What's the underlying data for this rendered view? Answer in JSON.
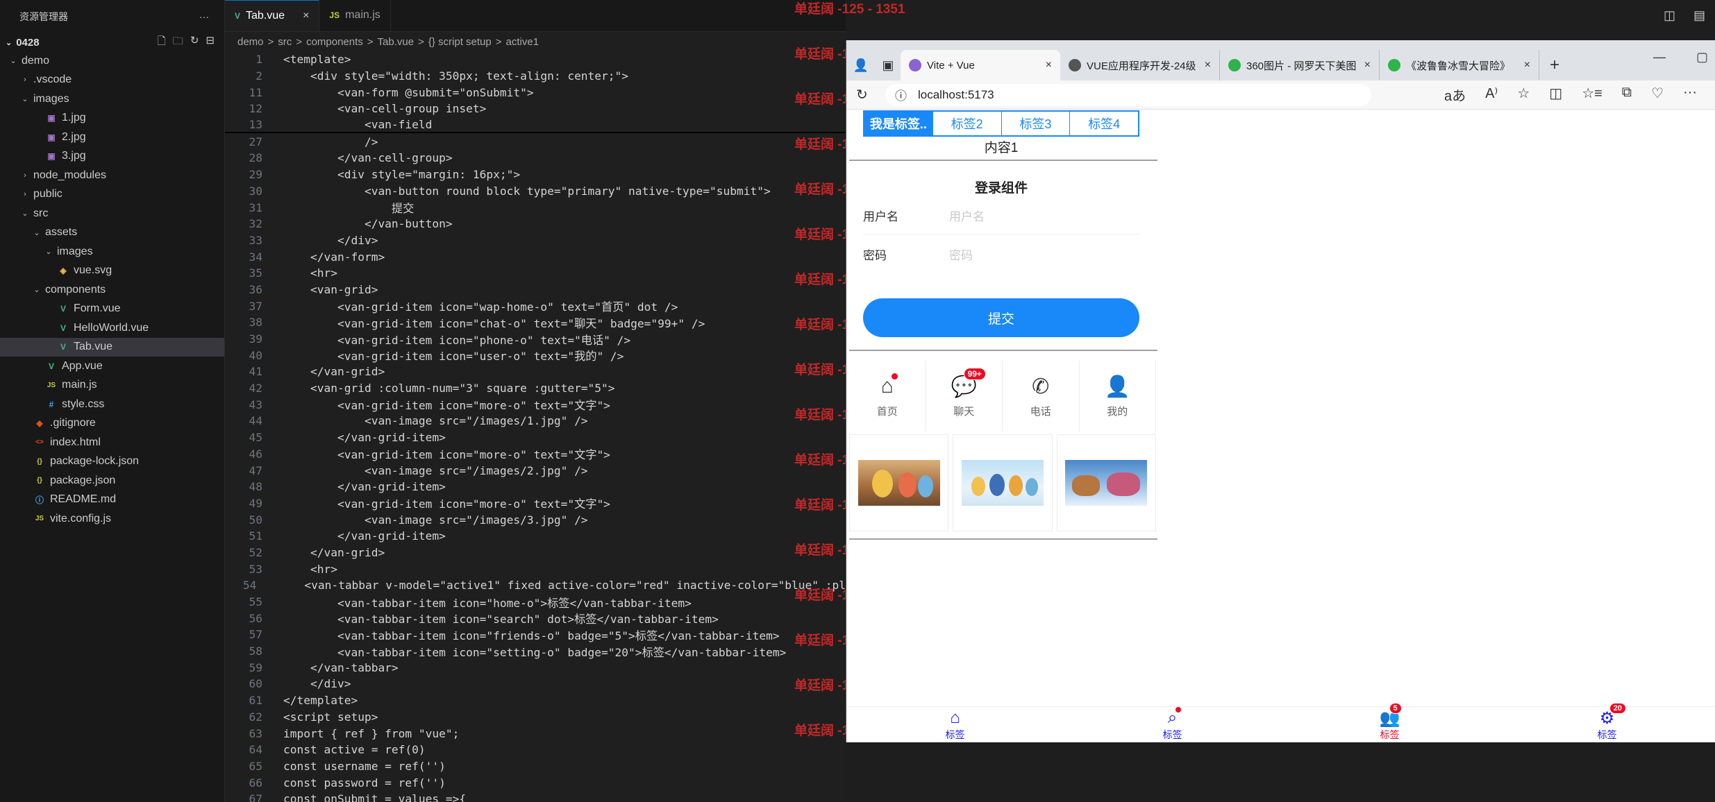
{
  "explorer": {
    "title": "资源管理器",
    "more": "···",
    "project": "0428",
    "items": [
      {
        "label": "demo",
        "icon": "folder-open",
        "chev": "⌄",
        "indent": 1
      },
      {
        "label": ".vscode",
        "icon": "folder",
        "chev": "›",
        "indent": 2
      },
      {
        "label": "images",
        "icon": "folder-open",
        "chev": "⌄",
        "indent": 2
      },
      {
        "label": "1.jpg",
        "icon": "image-file",
        "chev": "",
        "indent": 3
      },
      {
        "label": "2.jpg",
        "icon": "image-file",
        "chev": "",
        "indent": 3
      },
      {
        "label": "3.jpg",
        "icon": "image-file",
        "chev": "",
        "indent": 3
      },
      {
        "label": "node_modules",
        "icon": "folder",
        "chev": "›",
        "indent": 2
      },
      {
        "label": "public",
        "icon": "folder",
        "chev": "›",
        "indent": 2
      },
      {
        "label": "src",
        "icon": "folder-open",
        "chev": "⌄",
        "indent": 2
      },
      {
        "label": "assets",
        "icon": "folder-open",
        "chev": "⌄",
        "indent": 3
      },
      {
        "label": "images",
        "icon": "folder-open",
        "chev": "⌄",
        "indent": 4
      },
      {
        "label": "vue.svg",
        "icon": "svg-file",
        "chev": "",
        "indent": 4
      },
      {
        "label": "components",
        "icon": "folder-open",
        "chev": "⌄",
        "indent": 3
      },
      {
        "label": "Form.vue",
        "icon": "vue-file",
        "chev": "",
        "indent": 4
      },
      {
        "label": "HelloWorld.vue",
        "icon": "vue-file",
        "chev": "",
        "indent": 4
      },
      {
        "label": "Tab.vue",
        "icon": "vue-file",
        "chev": "",
        "indent": 4,
        "selected": true
      },
      {
        "label": "App.vue",
        "icon": "vue-file",
        "chev": "",
        "indent": 3
      },
      {
        "label": "main.js",
        "icon": "js-file",
        "chev": "",
        "indent": 3
      },
      {
        "label": "style.css",
        "icon": "css-file",
        "chev": "",
        "indent": 3
      },
      {
        "label": ".gitignore",
        "icon": "git-file",
        "chev": "",
        "indent": 2
      },
      {
        "label": "index.html",
        "icon": "html-file",
        "chev": "",
        "indent": 2
      },
      {
        "label": "package-lock.json",
        "icon": "json-file",
        "chev": "",
        "indent": 2
      },
      {
        "label": "package.json",
        "icon": "json-file",
        "chev": "",
        "indent": 2
      },
      {
        "label": "README.md",
        "icon": "info-file",
        "chev": "",
        "indent": 2
      },
      {
        "label": "vite.config.js",
        "icon": "js-file",
        "chev": "",
        "indent": 2
      }
    ]
  },
  "editor": {
    "tabs": [
      {
        "label": "Tab.vue",
        "active": true,
        "close": "×"
      },
      {
        "label": "main.js",
        "active": false,
        "close": ""
      }
    ],
    "breadcrumbs": [
      "demo",
      ">",
      "src",
      ">",
      "components",
      ">",
      "Tab.vue",
      ">",
      "{} script setup",
      ">",
      "active1"
    ],
    "lines": [
      {
        "no": "1",
        "text": "<template>"
      },
      {
        "no": "2",
        "text": "    <div style=\"width: 350px; text-align: center;\">"
      },
      {
        "no": "11",
        "text": "        <van-form @submit=\"onSubmit\">"
      },
      {
        "no": "12",
        "text": "        <van-cell-group inset>"
      },
      {
        "no": "13",
        "text": "            <van-field"
      },
      {
        "no": "27",
        "text": "            />"
      },
      {
        "no": "28",
        "text": "        </van-cell-group>"
      },
      {
        "no": "29",
        "text": "        <div style=\"margin: 16px;\">"
      },
      {
        "no": "30",
        "text": "            <van-button round block type=\"primary\" native-type=\"submit\">"
      },
      {
        "no": "31",
        "text": "                提交"
      },
      {
        "no": "32",
        "text": "            </van-button>"
      },
      {
        "no": "33",
        "text": "        </div>"
      },
      {
        "no": "34",
        "text": "    </van-form>"
      },
      {
        "no": "35",
        "text": "    <hr>"
      },
      {
        "no": "36",
        "text": "    <van-grid>"
      },
      {
        "no": "37",
        "text": "        <van-grid-item icon=\"wap-home-o\" text=\"首页\" dot />"
      },
      {
        "no": "38",
        "text": "        <van-grid-item icon=\"chat-o\" text=\"聊天\" badge=\"99+\" />"
      },
      {
        "no": "39",
        "text": "        <van-grid-item icon=\"phone-o\" text=\"电话\" />"
      },
      {
        "no": "40",
        "text": "        <van-grid-item icon=\"user-o\" text=\"我的\" />"
      },
      {
        "no": "41",
        "text": "    </van-grid>"
      },
      {
        "no": "42",
        "text": "    <van-grid :column-num=\"3\" square :gutter=\"5\">"
      },
      {
        "no": "43",
        "text": "        <van-grid-item icon=\"more-o\" text=\"文字\">"
      },
      {
        "no": "44",
        "text": "            <van-image src=\"/images/1.jpg\" />"
      },
      {
        "no": "45",
        "text": "        </van-grid-item>"
      },
      {
        "no": "46",
        "text": "        <van-grid-item icon=\"more-o\" text=\"文字\">"
      },
      {
        "no": "47",
        "text": "            <van-image src=\"/images/2.jpg\" />"
      },
      {
        "no": "48",
        "text": "        </van-grid-item>"
      },
      {
        "no": "49",
        "text": "        <van-grid-item icon=\"more-o\" text=\"文字\">"
      },
      {
        "no": "50",
        "text": "            <van-image src=\"/images/3.jpg\" />"
      },
      {
        "no": "51",
        "text": "        </van-grid-item>"
      },
      {
        "no": "52",
        "text": "    </van-grid>"
      },
      {
        "no": "53",
        "text": "    <hr>"
      },
      {
        "no": "54",
        "text": "    <van-tabbar v-model=\"active1\" fixed active-color=\"red\" inactive-color=\"blue\" :pl"
      },
      {
        "no": "55",
        "text": "        <van-tabbar-item icon=\"home-o\">标签</van-tabbar-item>"
      },
      {
        "no": "56",
        "text": "        <van-tabbar-item icon=\"search\" dot>标签</van-tabbar-item>"
      },
      {
        "no": "57",
        "text": "        <van-tabbar-item icon=\"friends-o\" badge=\"5\">标签</van-tabbar-item>"
      },
      {
        "no": "58",
        "text": "        <van-tabbar-item icon=\"setting-o\" badge=\"20\">标签</van-tabbar-item>"
      },
      {
        "no": "59",
        "text": "    </van-tabbar>"
      },
      {
        "no": "60",
        "text": "    </div>"
      },
      {
        "no": "61",
        "text": "</template>"
      },
      {
        "no": "62",
        "text": "<script setup>"
      },
      {
        "no": "63",
        "text": "import { ref } from \"vue\";"
      },
      {
        "no": "64",
        "text": "const active = ref(0)"
      },
      {
        "no": "65",
        "text": "const username = ref('')"
      },
      {
        "no": "66",
        "text": "const password = ref('')"
      },
      {
        "no": "67",
        "text": "const onSubmit = values =>{"
      }
    ]
  },
  "watermark": {
    "text": "单廷阔 -125 - 1351",
    "count": 17
  },
  "browser": {
    "tabs": [
      {
        "label": "Vite + Vue",
        "active": true,
        "icon_color": "#8a63d2"
      },
      {
        "label": "VUE应用程序开发-24级",
        "active": false,
        "icon_color": "#555555"
      },
      {
        "label": "360图片 - 网罗天下美图",
        "active": false,
        "icon_color": "#2fb34a"
      },
      {
        "label": "《波鲁鲁冰雪大冒险》",
        "active": false,
        "icon_color": "#2fb34a"
      }
    ],
    "new_tab": "+",
    "window_controls": [
      "—",
      "▢"
    ],
    "url": "localhost:5173",
    "info_icon": "ⓘ",
    "toolbar_icons": [
      "aあ",
      "A⁾",
      "☆",
      "◫",
      "☆≡",
      "⧉",
      "♡",
      "···"
    ]
  },
  "app": {
    "tabs": [
      {
        "label": "我是标签..",
        "active": true
      },
      {
        "label": "标签2",
        "active": false
      },
      {
        "label": "标签3",
        "active": false
      },
      {
        "label": "标签4",
        "active": false
      }
    ],
    "content": "内容1",
    "login_title": "登录组件",
    "username_label": "用户名",
    "username_placeholder": "用户名",
    "password_label": "密码",
    "password_placeholder": "密码",
    "submit_label": "提交",
    "grid": [
      {
        "label": "首页",
        "icon": "⌂",
        "dot": true,
        "badge": ""
      },
      {
        "label": "聊天",
        "icon": "💬",
        "dot": false,
        "badge": "99+"
      },
      {
        "label": "电话",
        "icon": "✆",
        "dot": false,
        "badge": ""
      },
      {
        "label": "我的",
        "icon": "👤",
        "dot": false,
        "badge": ""
      }
    ],
    "tabbar": [
      {
        "label": "标签",
        "icon": "⌂",
        "color": "#1a1aff",
        "dot": false,
        "badge": ""
      },
      {
        "label": "标签",
        "icon": "⌕",
        "color": "#1a1aff",
        "dot": true,
        "badge": ""
      },
      {
        "label": "标签",
        "icon": "👥",
        "color": "#ee0a24",
        "dot": false,
        "badge": "5"
      },
      {
        "label": "标签",
        "icon": "⚙",
        "color": "#1a1aff",
        "dot": false,
        "badge": "20"
      }
    ]
  },
  "colors": {
    "accent": "#1989fa",
    "badge": "#ee0a24",
    "watermark": "#d52a2a"
  }
}
